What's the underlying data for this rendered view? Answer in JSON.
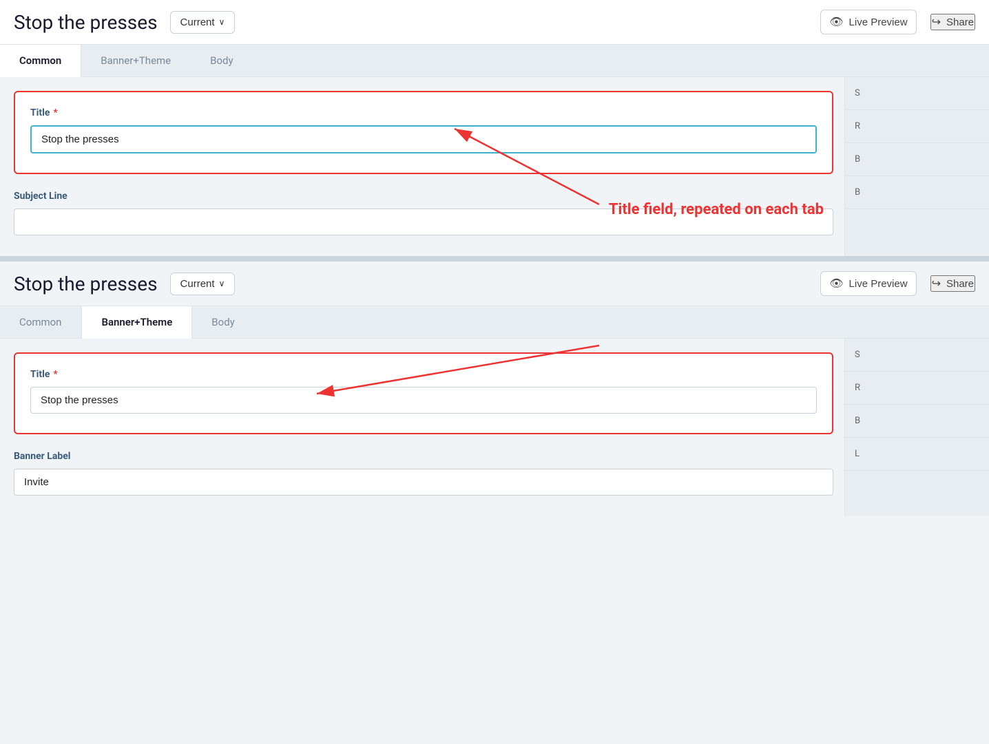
{
  "app": {
    "page_title": "Stop the presses",
    "dropdown_label": "Current",
    "live_preview_label": "Live Preview",
    "share_label": "Share"
  },
  "top_section": {
    "tabs": [
      {
        "id": "common",
        "label": "Common",
        "active": true
      },
      {
        "id": "banner_theme",
        "label": "Banner+Theme",
        "active": false
      },
      {
        "id": "body",
        "label": "Body",
        "active": false
      }
    ],
    "title_field": {
      "label": "Title",
      "required": true,
      "value": "Stop the presses",
      "placeholder": ""
    },
    "subject_line_field": {
      "label": "Subject Line",
      "required": false,
      "value": "",
      "placeholder": ""
    }
  },
  "bottom_section": {
    "tabs": [
      {
        "id": "common",
        "label": "Common",
        "active": false
      },
      {
        "id": "banner_theme",
        "label": "Banner+Theme",
        "active": true
      },
      {
        "id": "body",
        "label": "Body",
        "active": false
      }
    ],
    "title_field": {
      "label": "Title",
      "required": true,
      "value": "Stop the presses",
      "placeholder": ""
    },
    "banner_label_field": {
      "label": "Banner Label",
      "required": false,
      "value": "Invite",
      "placeholder": ""
    }
  },
  "annotation": {
    "text": "Title field, repeated on each tab"
  },
  "right_panel_top": {
    "items": [
      "S",
      "R",
      "B",
      "B"
    ]
  },
  "right_panel_bottom": {
    "items": [
      "S",
      "R",
      "B",
      "L"
    ]
  }
}
